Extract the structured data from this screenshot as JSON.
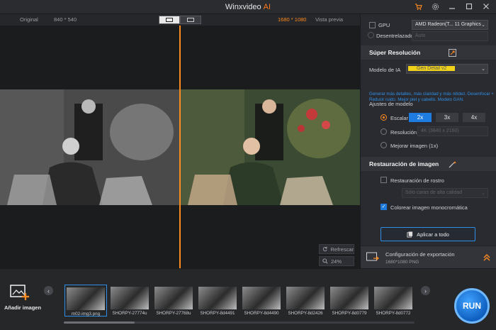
{
  "app": {
    "name": "Winxvideo",
    "suffix": "AI"
  },
  "compare": {
    "original_label": "Original",
    "original_size": "840 * 540",
    "output_size": "1680 * 1080",
    "preview_label": "Vista previa"
  },
  "preview_controls": {
    "refresh_label": "Refrescar",
    "zoom_label": "24%"
  },
  "panel": {
    "gpu_label": "GPU",
    "gpu_value": "AMD Radeon(T... 11 Graphics",
    "deinterlace_label": "Desentrelazado",
    "deinterlace_value": "Auto",
    "super_res_title": "Súper Resolución",
    "model_label": "Modelo de IA",
    "model_value": "Gen Detail v2",
    "model_note": "Generar más detalles, más claridad y más nitidez. Desenfocar + Reducir ruido. Mejor piel y cabello. Modelo GAN.",
    "model_settings_label": "Ajustes de modelo",
    "scale_label": "Escalar",
    "scale_options": [
      "2x",
      "3x",
      "4x"
    ],
    "resolution_label": "Resolución",
    "resolution_value": "4K (3840 x 2160)",
    "enhance_label": "Mejorar imagen (1x)",
    "restore_title": "Restauración de imagen",
    "face_restore_label": "Restauración de rostro",
    "face_restore_value": "Sólo caras de alta calidad",
    "colorize_label": "Colorear imagen monocromática",
    "apply_all_label": "Aplicar a todo",
    "export_title": "Configuración de exportación",
    "export_detail": "1680*1080  PNG"
  },
  "bottom": {
    "add_image_label": "Añadir imagen",
    "thumbnails": [
      "m02-img3.png",
      "SHORPY-27774u",
      "SHORPY-27768u",
      "SHORPY-8d4491",
      "SHORPY-8d4490",
      "SHORPY-8d2426",
      "SHORPY-8d0779",
      "SHORPY-8d0772"
    ],
    "run_label": "RUN"
  },
  "colors": {
    "accent_orange": "#ff8a1e",
    "accent_blue": "#1e7be0",
    "model_yellow": "#f0d21a"
  },
  "icons": [
    "cart-icon",
    "settings-icon",
    "minimize-icon",
    "maximize-icon",
    "close-icon",
    "refresh-icon",
    "zoom-icon",
    "compare-icon",
    "wand-icon",
    "export-icon",
    "expand-up-icon",
    "apply-icon",
    "add-image-icon"
  ]
}
